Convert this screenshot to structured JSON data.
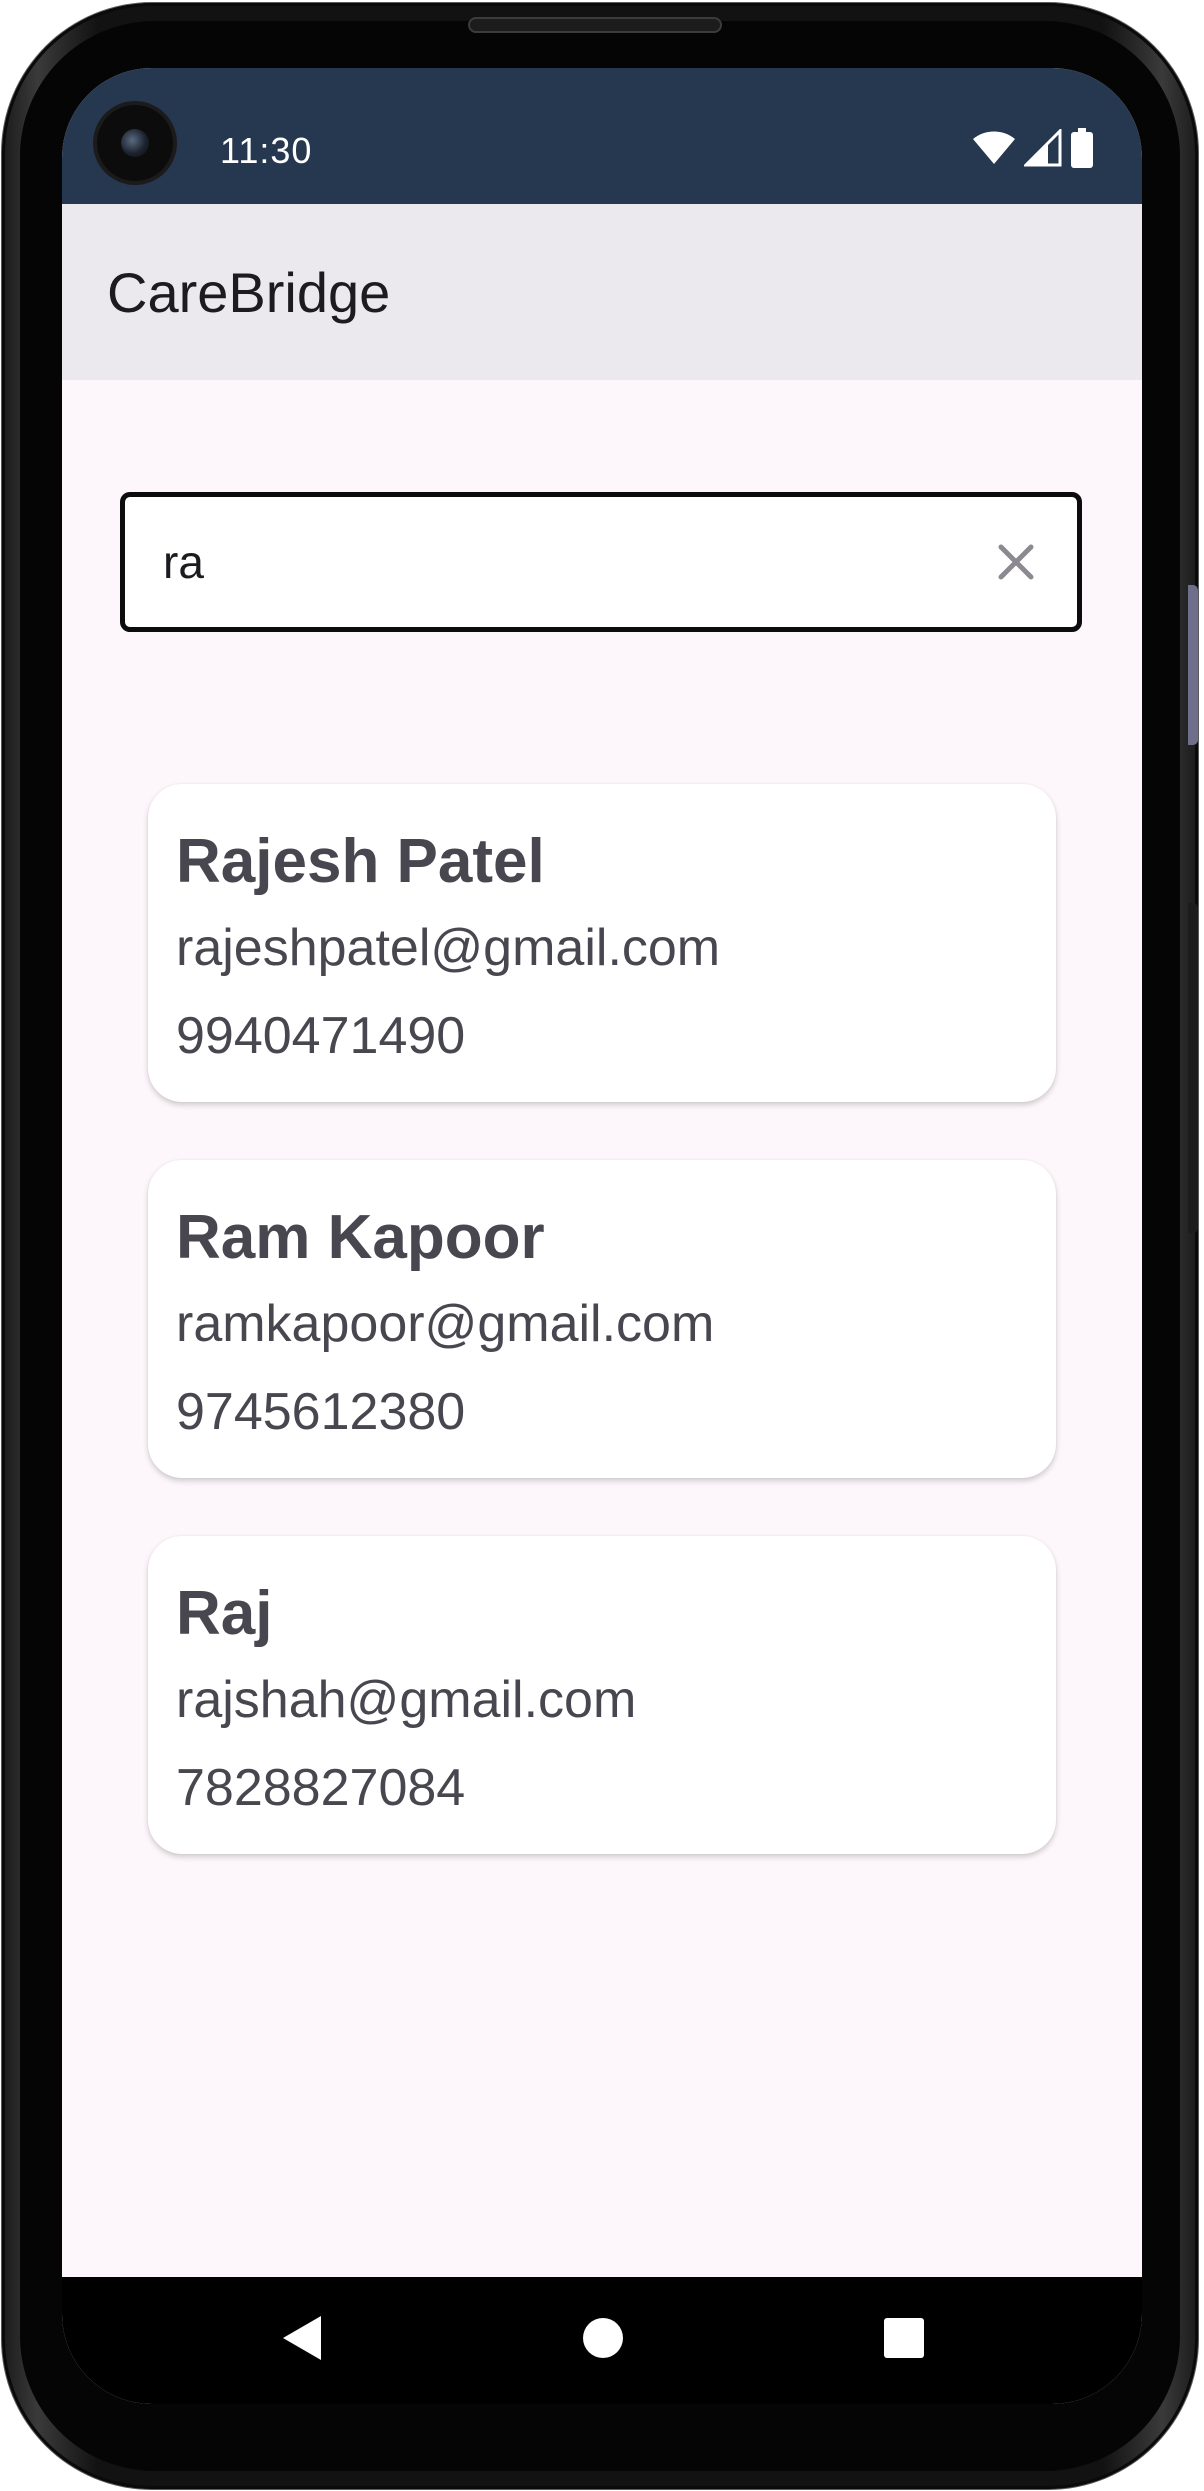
{
  "status_bar": {
    "time": "11:30",
    "icons": [
      "wifi-icon",
      "cell-signal-icon",
      "battery-icon"
    ]
  },
  "app_bar": {
    "title": "CareBridge"
  },
  "search": {
    "value": "ra",
    "clear_icon": "close-icon"
  },
  "results": [
    {
      "name": "Rajesh Patel",
      "email": "rajeshpatel@gmail.com",
      "phone": "9940471490"
    },
    {
      "name": "Ram Kapoor",
      "email": "ramkapoor@gmail.com",
      "phone": "9745612380"
    },
    {
      "name": "Raj",
      "email": "rajshah@gmail.com",
      "phone": "7828827084"
    }
  ],
  "nav_bar": {
    "buttons": [
      "back-icon",
      "home-icon",
      "recents-icon"
    ]
  },
  "colors": {
    "status_bar": "#263750",
    "app_bar": "#ebe9ee",
    "background": "#fdf7fb",
    "card": "#ffffff",
    "card_text": "#48464f"
  }
}
